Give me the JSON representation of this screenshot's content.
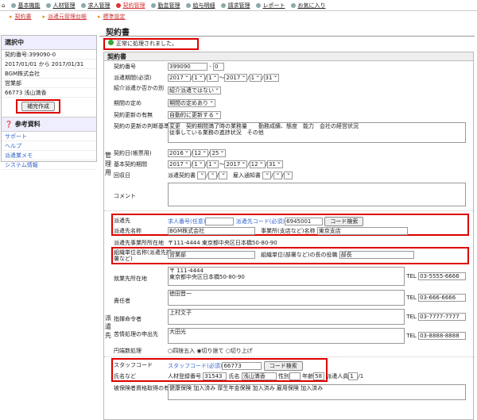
{
  "nav": [
    "基本機能",
    "人材管理",
    "求人管理",
    "契約管理",
    "勤怠管理",
    "給与明細",
    "請求管理",
    "レポート",
    "お気に入り"
  ],
  "subnav": [
    "契約書",
    "派遣元管理台帳",
    "標準設定"
  ],
  "side": {
    "title": "選択中",
    "items": [
      "契約番号:399090-0",
      "2017/01/01 から 2017/01/31",
      "BGM株式会社",
      "営業部",
      "66773 浅山満香"
    ],
    "btn": "補完作成",
    "ref_title": "参考資料",
    "links": [
      "サポート",
      "ヘルプ",
      "派遣業メモ",
      "システム情報"
    ]
  },
  "main": {
    "title": "契約書",
    "msg": "正常に処理されました。",
    "section": "契約書",
    "g1": "管理用",
    "g2": "派遣先",
    "f": {
      "no_l": "契約番号",
      "no": "399090",
      "no2": "0",
      "per_l": "派遣期間(必須)",
      "y": "2017",
      "m": "1",
      "d": "1",
      "tilde": "〜",
      "y2": "2017",
      "m2": "1",
      "d2": "31",
      "intro_l": "紹介派遣か否かの別",
      "intro": "紹介派遣ではない",
      "term_l": "期間の定め",
      "term": "期間の定めあり",
      "renew_l": "契約更新の有無",
      "renew": "自動的に更新する",
      "crit_l": "契約の更新の判断基準",
      "crit": "変更　契約期間満了時の業務量　　勤務成績、態度　能力　会社の経営状況\n従事している業務の進捗状況　その他",
      "date_l": "契約日(帳票用)",
      "dy": "2016",
      "dm": "12",
      "dd": "25",
      "base_l": "基本契約期間",
      "by": "2017",
      "bm": "1",
      "bd": "1",
      "by2": "2017",
      "bm2": "12",
      "bd2": "31",
      "col_l": "回収日",
      "col1": "派遣契約書",
      "col2": "雇入通知書",
      "comment_l": "コメント",
      "dest_l": "派遣先",
      "dest1": "求人番号(任意)",
      "dest2": "派遣先コード(必須)",
      "dest_code": "6945001",
      "search": "コード検索",
      "name_l": "派遣先名称",
      "name": "BGM株式会社",
      "office_l": "事業所(支店など)名称",
      "office": "東京支店",
      "addr_l": "派遣先事業所所在地",
      "addr": "〒111-4444 東京都中央区日本橋50-80-90",
      "org_l": "組織単位名称(派遣先部署など)",
      "org": "営業部",
      "org_h_l": "組織単位(部署など)の長の役職",
      "org_h": "部長",
      "work_l": "就業先所在地",
      "work": "〒 111-4444\n東京都中央区日本橋50-80-90",
      "tel": "TEL",
      "tel1": "03-5555-6666",
      "resp_l": "責任者",
      "resp": "徳田晋一",
      "tel2": "03-666-6666",
      "cmd_l": "指揮命令者",
      "cmd": "上村文子",
      "tel3": "03-7777-7777",
      "comp_l": "苦情処理の申出先",
      "comp": "大田光",
      "tel4": "03-8888-8888",
      "round_l": "円端数処理",
      "r1": "四捨五入",
      "r2": "切り捨て",
      "r3": "切り上げ",
      "staff_l": "スタッフコード",
      "staff_link": "スタッフコード(必須)",
      "staff_code": "66773",
      "search2": "コード検索",
      "sname_l": "氏名など",
      "lic": "人材登録番号",
      "lic_no": "31543",
      "sn_l": "氏名",
      "sname": "浅山満香",
      "sex_l": "性別",
      "age_l": "年齢",
      "age": "58",
      "num_l": "派遣人員",
      "num": "1",
      "num2": "/1",
      "ins_l": "被保険者資格取得の有無",
      "ins": "健康保険 加入済み  厚生年金保険 加入済み  雇用保険 加入済み"
    }
  }
}
